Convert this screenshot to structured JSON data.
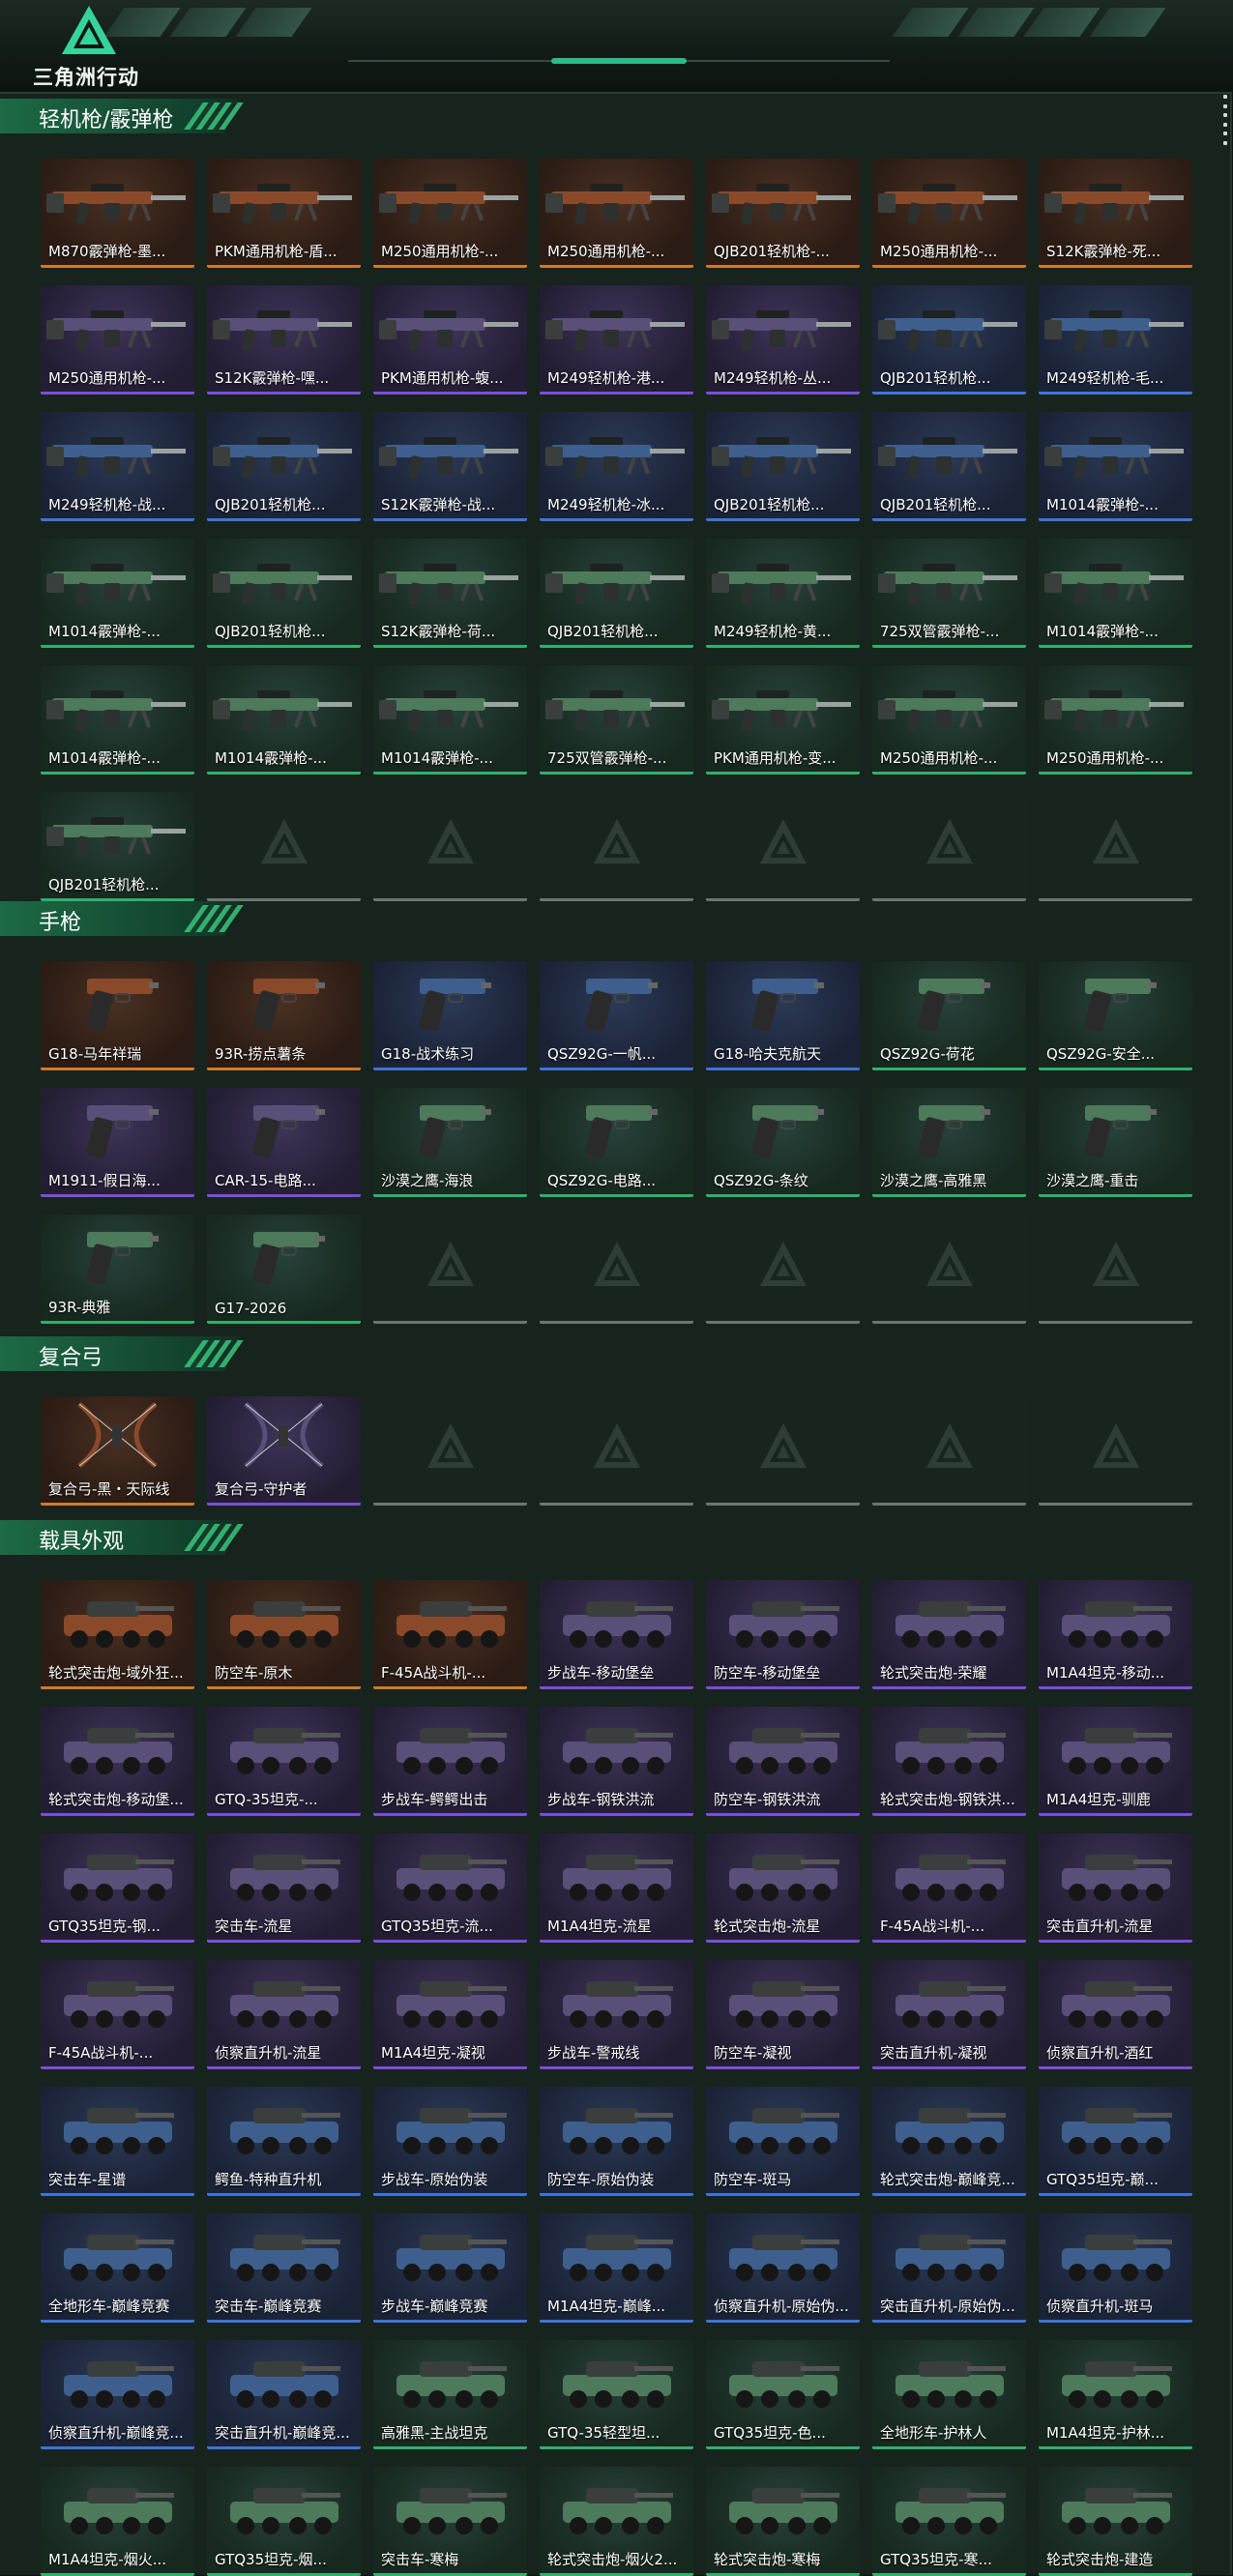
{
  "app": {
    "logo_text": "三角洲行动"
  },
  "colors": {
    "rarity_purple": "#7a4fd8",
    "rarity_blue": "#3e74d8",
    "rarity_green": "#2fb06e",
    "rarity_orange": "#d07a2a",
    "accent": "#2fb88a"
  },
  "sections": [
    {
      "title": "轻机枪/霰弹枪",
      "kind": "gun",
      "items": [
        {
          "label": "M870霰弹枪-墨...",
          "rarity": "orange"
        },
        {
          "label": "PKM通用机枪-盾...",
          "rarity": "orange"
        },
        {
          "label": "M250通用机枪-...",
          "rarity": "orange"
        },
        {
          "label": "M250通用机枪-...",
          "rarity": "orange"
        },
        {
          "label": "QJB201轻机枪-...",
          "rarity": "orange"
        },
        {
          "label": "M250通用机枪-...",
          "rarity": "orange"
        },
        {
          "label": "S12K霰弹枪-死...",
          "rarity": "orange"
        },
        {
          "label": "M250通用机枪-...",
          "rarity": "purple"
        },
        {
          "label": "S12K霰弹枪-嘿...",
          "rarity": "purple"
        },
        {
          "label": "PKM通用机枪-蝮...",
          "rarity": "purple"
        },
        {
          "label": "M249轻机枪-港...",
          "rarity": "purple"
        },
        {
          "label": "M249轻机枪-丛...",
          "rarity": "purple"
        },
        {
          "label": "QJB201轻机枪...",
          "rarity": "blue"
        },
        {
          "label": "M249轻机枪-毛...",
          "rarity": "blue"
        },
        {
          "label": "M249轻机枪-战...",
          "rarity": "blue"
        },
        {
          "label": "QJB201轻机枪...",
          "rarity": "blue"
        },
        {
          "label": "S12K霰弹枪-战...",
          "rarity": "blue"
        },
        {
          "label": "M249轻机枪-冰...",
          "rarity": "blue"
        },
        {
          "label": "QJB201轻机枪...",
          "rarity": "blue"
        },
        {
          "label": "QJB201轻机枪...",
          "rarity": "blue"
        },
        {
          "label": "M1014霰弹枪-...",
          "rarity": "blue"
        },
        {
          "label": "M1014霰弹枪-...",
          "rarity": "green"
        },
        {
          "label": "QJB201轻机枪...",
          "rarity": "green"
        },
        {
          "label": "S12K霰弹枪-荷...",
          "rarity": "green"
        },
        {
          "label": "QJB201轻机枪...",
          "rarity": "green"
        },
        {
          "label": "M249轻机枪-黄...",
          "rarity": "green"
        },
        {
          "label": "725双管霰弹枪-...",
          "rarity": "green"
        },
        {
          "label": "M1014霰弹枪-...",
          "rarity": "green"
        },
        {
          "label": "M1014霰弹枪-...",
          "rarity": "green"
        },
        {
          "label": "M1014霰弹枪-...",
          "rarity": "green"
        },
        {
          "label": "M1014霰弹枪-...",
          "rarity": "green"
        },
        {
          "label": "725双管霰弹枪-...",
          "rarity": "green"
        },
        {
          "label": "PKM通用机枪-变...",
          "rarity": "green"
        },
        {
          "label": "M250通用机枪-...",
          "rarity": "green"
        },
        {
          "label": "M250通用机枪-...",
          "rarity": "green"
        },
        {
          "label": "QJB201轻机枪...",
          "rarity": "green"
        }
      ],
      "empty_slots": 6
    },
    {
      "title": "手枪",
      "kind": "pistol",
      "items": [
        {
          "label": "G18-马年祥瑞",
          "rarity": "orange"
        },
        {
          "label": "93R-捞点薯条",
          "rarity": "orange"
        },
        {
          "label": "G18-战术练习",
          "rarity": "blue"
        },
        {
          "label": "QSZ92G-一帆...",
          "rarity": "blue"
        },
        {
          "label": "G18-哈夫克航天",
          "rarity": "blue"
        },
        {
          "label": "QSZ92G-荷花",
          "rarity": "green"
        },
        {
          "label": "QSZ92G-安全...",
          "rarity": "green"
        },
        {
          "label": "M1911-假日海...",
          "rarity": "purple"
        },
        {
          "label": "CAR-15-电路...",
          "rarity": "purple"
        },
        {
          "label": "沙漠之鹰-海浪",
          "rarity": "green"
        },
        {
          "label": "QSZ92G-电路...",
          "rarity": "green"
        },
        {
          "label": "QSZ92G-条纹",
          "rarity": "green"
        },
        {
          "label": "沙漠之鹰-高雅黑",
          "rarity": "green"
        },
        {
          "label": "沙漠之鹰-重击",
          "rarity": "green"
        },
        {
          "label": "93R-典雅",
          "rarity": "green"
        },
        {
          "label": "G17-2026",
          "rarity": "green"
        }
      ],
      "empty_slots": 5
    },
    {
      "title": "复合弓",
      "kind": "bow",
      "items": [
        {
          "label": "复合弓-黑・天际线",
          "rarity": "orange"
        },
        {
          "label": "复合弓-守护者",
          "rarity": "purple"
        }
      ],
      "empty_slots": 5
    },
    {
      "title": "载具外观",
      "kind": "vehicle",
      "items": [
        {
          "label": "轮式突击炮-域外狂...",
          "rarity": "orange"
        },
        {
          "label": "防空车-原木",
          "rarity": "orange"
        },
        {
          "label": "F-45A战斗机-...",
          "rarity": "orange"
        },
        {
          "label": "步战车-移动堡垒",
          "rarity": "purple"
        },
        {
          "label": "防空车-移动堡垒",
          "rarity": "purple"
        },
        {
          "label": "轮式突击炮-荣耀",
          "rarity": "purple"
        },
        {
          "label": "M1A4坦克-移动...",
          "rarity": "purple"
        },
        {
          "label": "轮式突击炮-移动堡...",
          "rarity": "purple"
        },
        {
          "label": "GTQ-35坦克-...",
          "rarity": "purple"
        },
        {
          "label": "步战车-鳄鳄出击",
          "rarity": "purple"
        },
        {
          "label": "步战车-钢铁洪流",
          "rarity": "purple"
        },
        {
          "label": "防空车-钢铁洪流",
          "rarity": "purple"
        },
        {
          "label": "轮式突击炮-钢铁洪...",
          "rarity": "purple"
        },
        {
          "label": "M1A4坦克-驯鹿",
          "rarity": "purple"
        },
        {
          "label": "GTQ35坦克-钢...",
          "rarity": "purple"
        },
        {
          "label": "突击车-流星",
          "rarity": "purple"
        },
        {
          "label": "GTQ35坦克-流...",
          "rarity": "purple"
        },
        {
          "label": "M1A4坦克-流星",
          "rarity": "purple"
        },
        {
          "label": "轮式突击炮-流星",
          "rarity": "purple"
        },
        {
          "label": "F-45A战斗机-...",
          "rarity": "purple"
        },
        {
          "label": "突击直升机-流星",
          "rarity": "purple"
        },
        {
          "label": "F-45A战斗机-...",
          "rarity": "purple"
        },
        {
          "label": "侦察直升机-流星",
          "rarity": "purple"
        },
        {
          "label": "M1A4坦克-凝视",
          "rarity": "purple"
        },
        {
          "label": "步战车-警戒线",
          "rarity": "purple"
        },
        {
          "label": "防空车-凝视",
          "rarity": "purple"
        },
        {
          "label": "突击直升机-凝视",
          "rarity": "purple"
        },
        {
          "label": "侦察直升机-酒红",
          "rarity": "purple"
        },
        {
          "label": "突击车-星谱",
          "rarity": "blue"
        },
        {
          "label": "鳄鱼-特种直升机",
          "rarity": "blue"
        },
        {
          "label": "步战车-原始伪装",
          "rarity": "blue"
        },
        {
          "label": "防空车-原始伪装",
          "rarity": "blue"
        },
        {
          "label": "防空车-斑马",
          "rarity": "blue"
        },
        {
          "label": "轮式突击炮-巅峰竞...",
          "rarity": "blue"
        },
        {
          "label": "GTQ35坦克-巅...",
          "rarity": "blue"
        },
        {
          "label": "全地形车-巅峰竞赛",
          "rarity": "blue"
        },
        {
          "label": "突击车-巅峰竞赛",
          "rarity": "blue"
        },
        {
          "label": "步战车-巅峰竞赛",
          "rarity": "blue"
        },
        {
          "label": "M1A4坦克-巅峰...",
          "rarity": "blue"
        },
        {
          "label": "侦察直升机-原始伪...",
          "rarity": "blue"
        },
        {
          "label": "突击直升机-原始伪...",
          "rarity": "blue"
        },
        {
          "label": "侦察直升机-斑马",
          "rarity": "blue"
        },
        {
          "label": "侦察直升机-巅峰竞...",
          "rarity": "blue"
        },
        {
          "label": "突击直升机-巅峰竞...",
          "rarity": "blue"
        },
        {
          "label": "高雅黑-主战坦克",
          "rarity": "green"
        },
        {
          "label": "GTQ-35轻型坦...",
          "rarity": "green"
        },
        {
          "label": "GTQ35坦克-色...",
          "rarity": "green"
        },
        {
          "label": "全地形车-护林人",
          "rarity": "green"
        },
        {
          "label": "M1A4坦克-护林...",
          "rarity": "green"
        },
        {
          "label": "M1A4坦克-烟火...",
          "rarity": "green"
        },
        {
          "label": "GTQ35坦克-烟...",
          "rarity": "green"
        },
        {
          "label": "突击车-寒梅",
          "rarity": "green"
        },
        {
          "label": "轮式突击炮-烟火2...",
          "rarity": "green"
        },
        {
          "label": "轮式突击炮-寒梅",
          "rarity": "green"
        },
        {
          "label": "GTQ35坦克-寒...",
          "rarity": "green"
        },
        {
          "label": "轮式突击炮-建造",
          "rarity": "green"
        }
      ],
      "empty_slots": 0
    }
  ]
}
